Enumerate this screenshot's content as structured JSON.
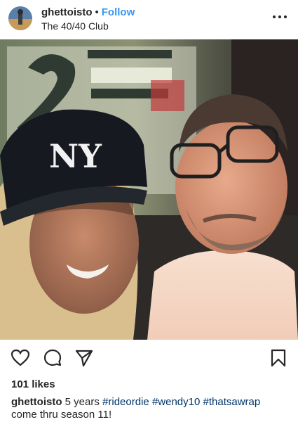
{
  "post": {
    "username": "ghettoisto",
    "separator": "•",
    "follow_label": "Follow",
    "location": "The 40/40 Club",
    "likes": "101 likes",
    "caption": {
      "text_before": "5 years",
      "hashtags": [
        "#rideordie",
        "#wendy10",
        "#thatsawrap"
      ],
      "text_after": "come thru season 11!"
    }
  },
  "icons": {
    "more": "more-options-icon",
    "like": "heart-icon",
    "comment": "comment-icon",
    "share": "share-icon",
    "save": "bookmark-icon"
  },
  "colors": {
    "follow": "#3897f0",
    "hashtag": "#003569",
    "text": "#262626"
  }
}
